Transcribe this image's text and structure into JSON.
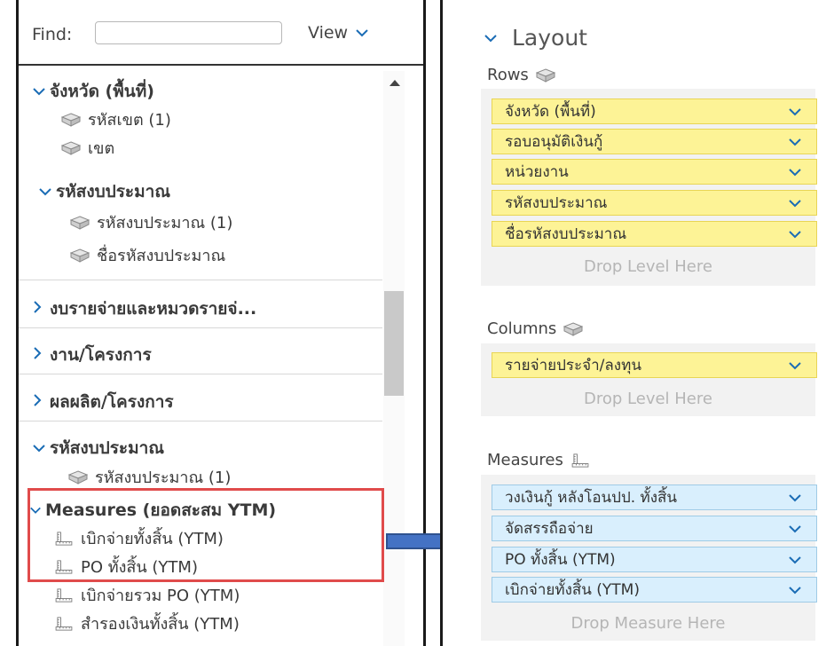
{
  "finder": {
    "find_label": "Find:",
    "find_value": "",
    "view_label": "View"
  },
  "tree": {
    "groups": [
      {
        "label": "จังหวัด (พื้นที่)",
        "expanded": true,
        "items": [
          "รหัสเขต (1)",
          "เขต"
        ]
      },
      {
        "label": "รหัสงบประมาณ",
        "expanded": true,
        "items": [
          "รหัสงบประมาณ (1)",
          "ชื่อรหัสงบประมาณ"
        ]
      },
      {
        "label": "งบรายจ่ายและหมวดรายจ่...",
        "expanded": false,
        "items": []
      },
      {
        "label": "งาน/โครงการ",
        "expanded": false,
        "items": []
      },
      {
        "label": "ผลผลิต/โครงการ",
        "expanded": false,
        "items": []
      },
      {
        "label": "รหัสงบประมาณ",
        "expanded": true,
        "items": [
          "รหัสงบประมาณ (1)"
        ]
      }
    ],
    "measures": {
      "label": "Measures (ยอดสะสม YTM)",
      "items": [
        "เบิกจ่ายทั้งสิ้น (YTM)",
        "PO ทั้งสิ้น (YTM)",
        "เบิกจ่ายรวม PO (YTM)",
        "สำรองเงินทั้งสิ้น (YTM)"
      ]
    }
  },
  "layout": {
    "title": "Layout",
    "rows_label": "Rows",
    "rows": [
      "จังหวัด (พื้นที่)",
      "รอบอนุมัติเงินกู้",
      "หน่วยงาน",
      "รหัสงบประมาณ",
      "ชื่อรหัสงบประมาณ"
    ],
    "rows_drop": "Drop Level Here",
    "columns_label": "Columns",
    "columns": [
      "รายจ่ายประจำ/ลงทุน"
    ],
    "columns_drop": "Drop Level Here",
    "measures_label": "Measures",
    "measures": [
      "วงเงินกู้ หลังโอนปป. ทั้งสิ้น",
      "จัดสรรถือจ่าย",
      "PO ทั้งสิ้น (YTM)",
      "เบิกจ่ายทั้งสิ้น (YTM)"
    ],
    "measures_drop": "Drop Measure Here"
  },
  "colors": {
    "accent": "#1a6cb5",
    "highlight_border": "#e04b4b",
    "arrow_fill": "#4472c4",
    "yellow_chip": "#fdf396",
    "blue_chip": "#d9effd"
  }
}
